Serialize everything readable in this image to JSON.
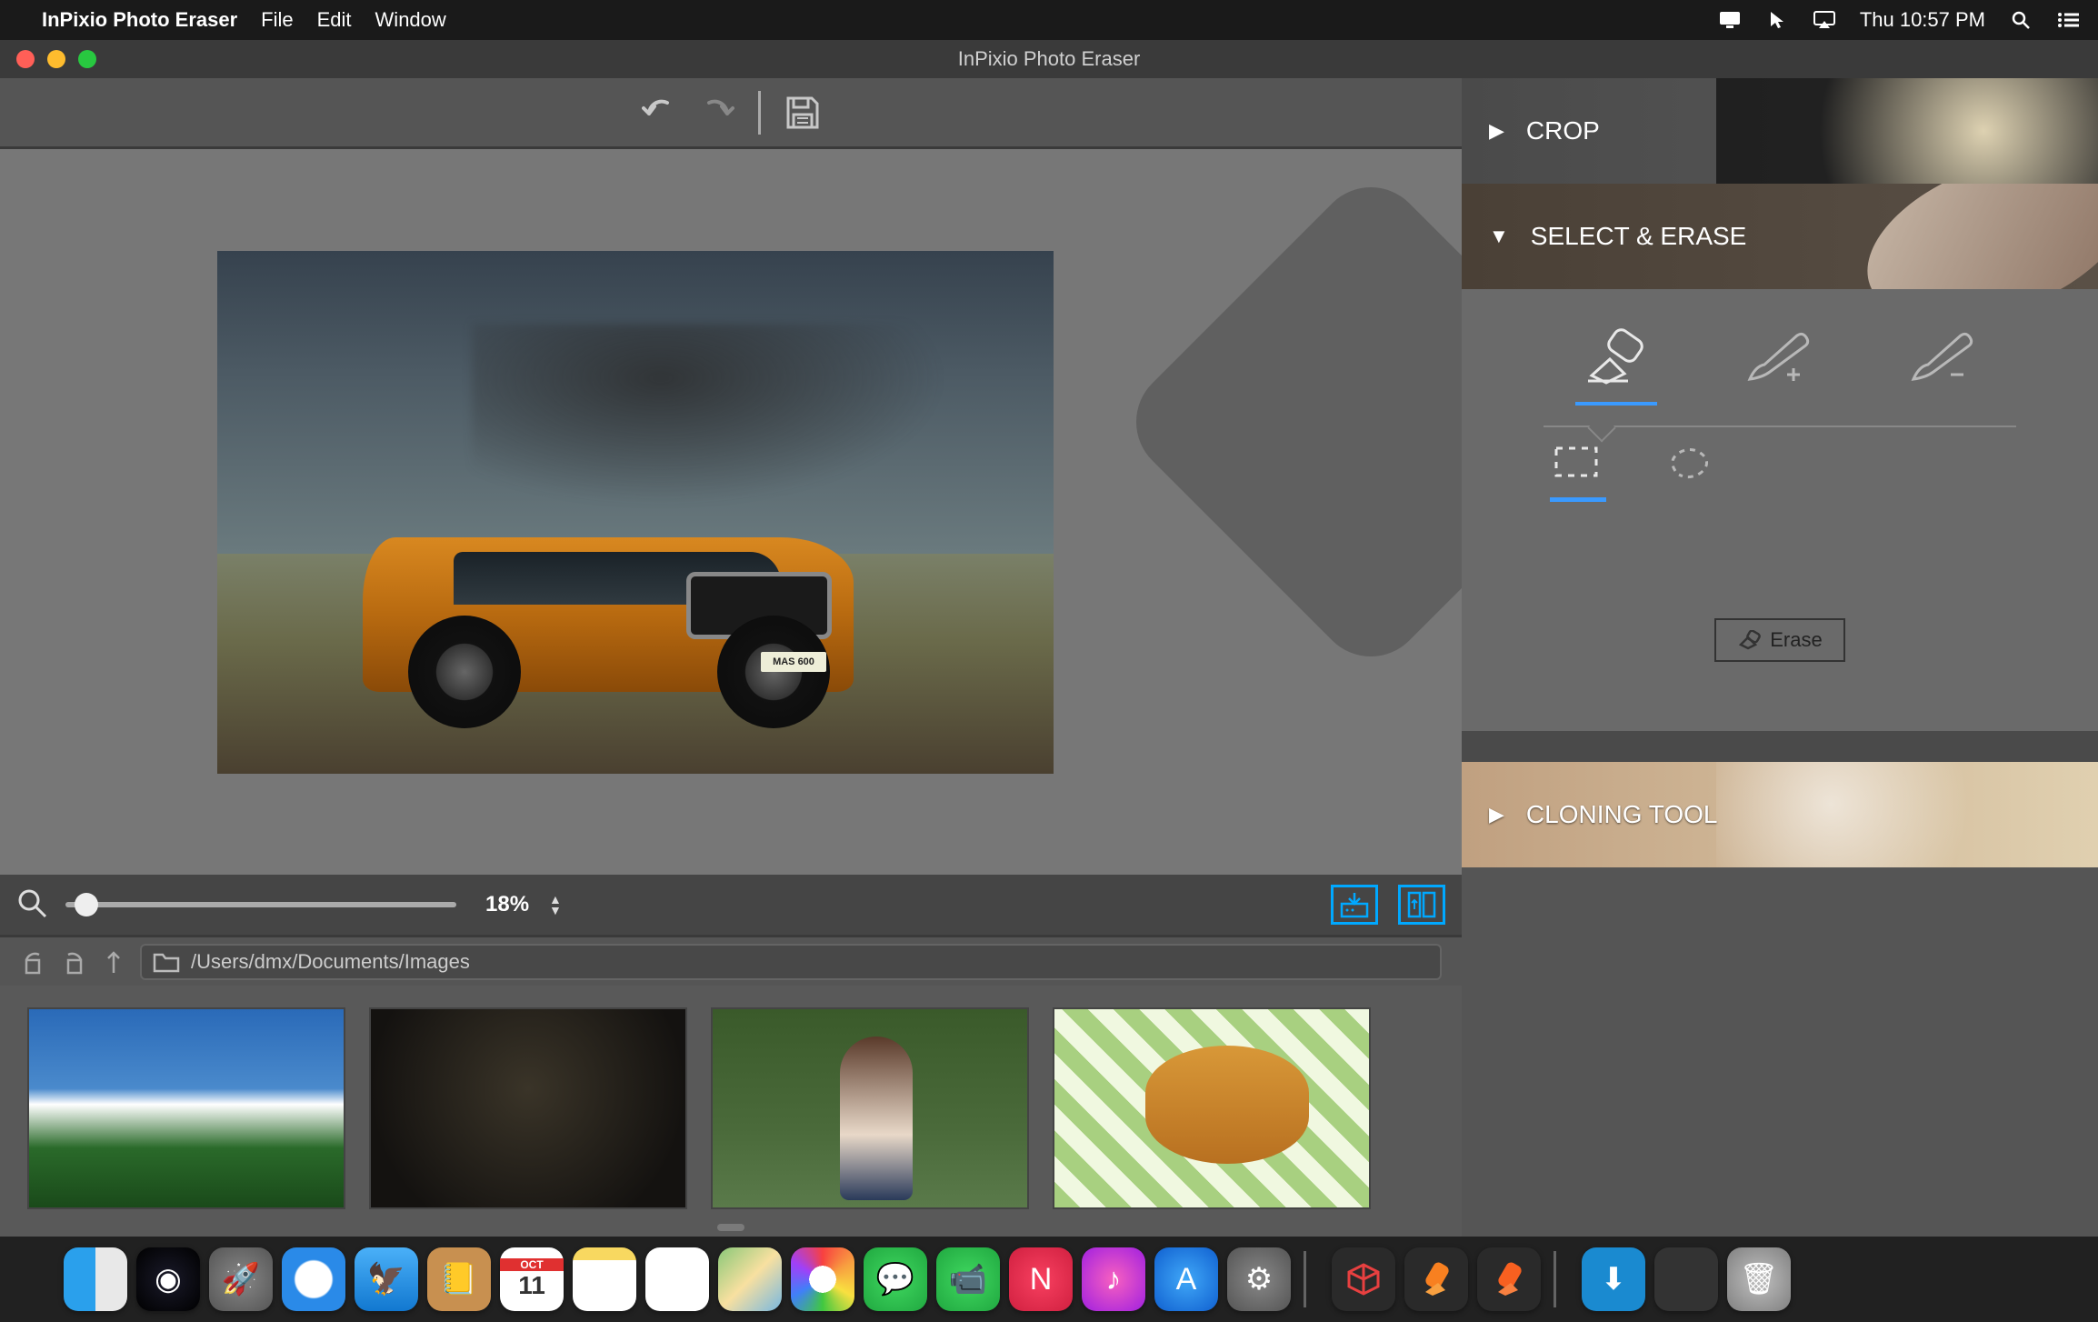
{
  "menubar": {
    "app_name": "InPixio Photo Eraser",
    "items": [
      "File",
      "Edit",
      "Window"
    ],
    "time": "Thu 10:57 PM"
  },
  "titlebar": {
    "title": "InPixio Photo Eraser"
  },
  "toolbar": {
    "undo": "undo",
    "redo": "redo",
    "save": "save"
  },
  "canvas": {
    "plate": "MAS 600"
  },
  "zoom": {
    "value": "18%"
  },
  "browser": {
    "path": "/Users/dmx/Documents/Images"
  },
  "panels": {
    "crop": "CROP",
    "erase": "SELECT & ERASE",
    "clone": "CLONING TOOL",
    "erase_btn": "Erase"
  },
  "dock": {
    "cal_month": "OCT",
    "cal_day": "11"
  }
}
